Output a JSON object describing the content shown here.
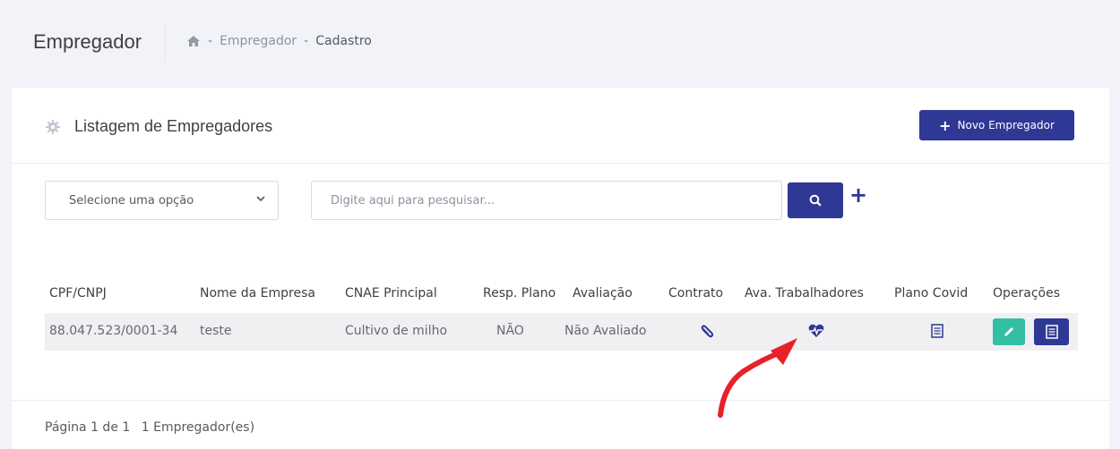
{
  "header": {
    "page_title": "Empregador",
    "breadcrumb": [
      "Empregador",
      "Cadastro"
    ],
    "breadcrumb_sep": "-"
  },
  "card": {
    "title": "Listagem de Empregadores",
    "new_button_label": "Novo Empregador"
  },
  "filters": {
    "select_value": "Selecione uma opção",
    "search_placeholder": "Digite aqui para pesquisar...",
    "add_filter_label": "+"
  },
  "table": {
    "columns": [
      "CPF/CNPJ",
      "Nome da Empresa",
      "CNAE Principal",
      "Resp. Plano",
      "Avaliação",
      "Contrato",
      "Ava. Trabalhadores",
      "Plano Covid",
      "Operações"
    ],
    "rows": [
      {
        "cpf_cnpj": "88.047.523/0001-34",
        "nome": "teste",
        "cnae": "Cultivo de milho",
        "resp_plano": "NÃO",
        "avaliacao": "Não Avaliado"
      }
    ]
  },
  "pager": {
    "text": "Página 1 de 1",
    "count": "1 Empregador(es)"
  },
  "colors": {
    "primary": "#2f3894",
    "success": "#34bfa3",
    "annotation": "#e8202a"
  }
}
